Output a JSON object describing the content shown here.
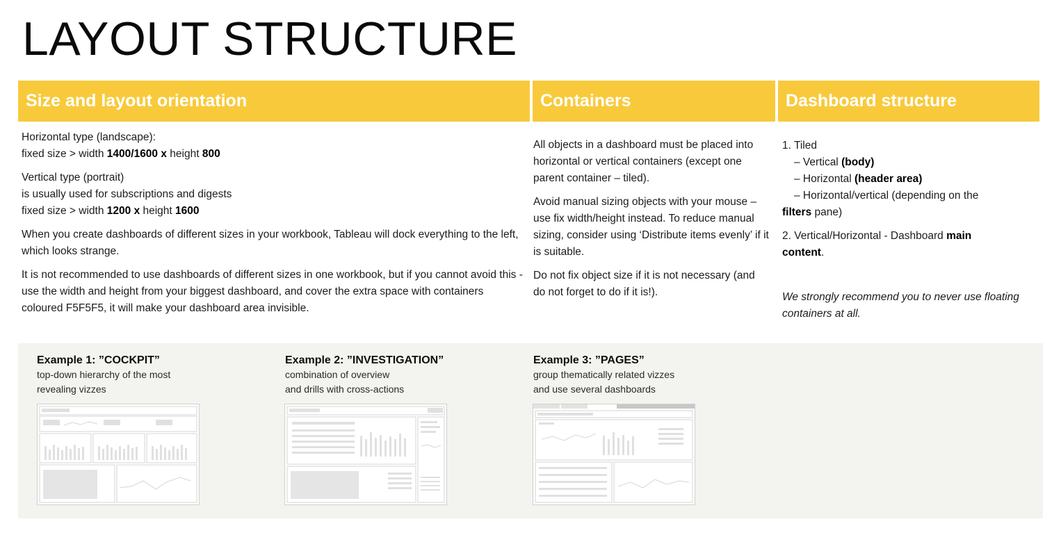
{
  "page": {
    "title": "LAYOUT STRUCTURE"
  },
  "colors": {
    "header_bg": "#f8ca3b",
    "header_text": "#ffffff",
    "examples_bg": "#f3f3ef"
  },
  "columns": {
    "size": {
      "header": "Size and layout orientation",
      "horizontal": {
        "heading": "Horizontal type (landscape):",
        "line_prefix": "fixed size >  width ",
        "width": "1400/1600",
        "x": " x ",
        "height_label": "height ",
        "height": "800"
      },
      "vertical": {
        "heading": "Vertical type (portrait)",
        "usage": "is usually used for subscriptions and digests",
        "line_prefix": "fixed size >  width ",
        "width": "1200",
        "x": " x ",
        "height_label": "height ",
        "height": "1600"
      },
      "para1": "When you create dashboards of different sizes in your workbook, Tableau will dock everything to the left, which looks strange.",
      "para2": "It is not recommended to use dashboards of different sizes in one workbook, but if you cannot avoid this - use the width and height from your biggest dashboard, and cover the extra space with containers coloured F5F5F5, it will make your dashboard area invisible."
    },
    "containers": {
      "header": "Containers",
      "para1": "All objects in a dashboard must be placed into horizontal or vertical containers (except one parent container – tiled).",
      "para2": "Avoid manual sizing objects with your mouse – use fix width/height instead. To reduce manual sizing, consider using ‘Distribute items evenly’ if it is suitable.",
      "para3": "Do not fix object size if it is not necessary (and do not forget to do if it is!)."
    },
    "structure": {
      "header": "Dashboard structure",
      "item1": "1. Tiled",
      "sub1_pre": "– Vertical ",
      "sub1_bold": "(body)",
      "sub2_pre": "– Horizontal ",
      "sub2_bold": "(header area)",
      "sub3": "– Horizontal/vertical (depending on the",
      "sub3_bold": "filters",
      "sub3_post": " pane)",
      "item2_pre": "2. Vertical/Horizontal - Dashboard ",
      "item2_bold1": "main",
      "item2_bold2": "content",
      "item2_post": ".",
      "note": "We strongly recommend you to never use floating containers at all."
    }
  },
  "examples": [
    {
      "title": "Example 1: ”COCKPIT”",
      "desc1": "top-down hierarchy of the most",
      "desc2": "revealing vizzes"
    },
    {
      "title": "Example 2: ”INVESTIGATION”",
      "desc1": "combination of overview",
      "desc2": "and drills with cross-actions"
    },
    {
      "title": "Example 3: ”PAGES”",
      "desc1": "group thematically related vizzes",
      "desc2": "and use several dashboards"
    }
  ]
}
